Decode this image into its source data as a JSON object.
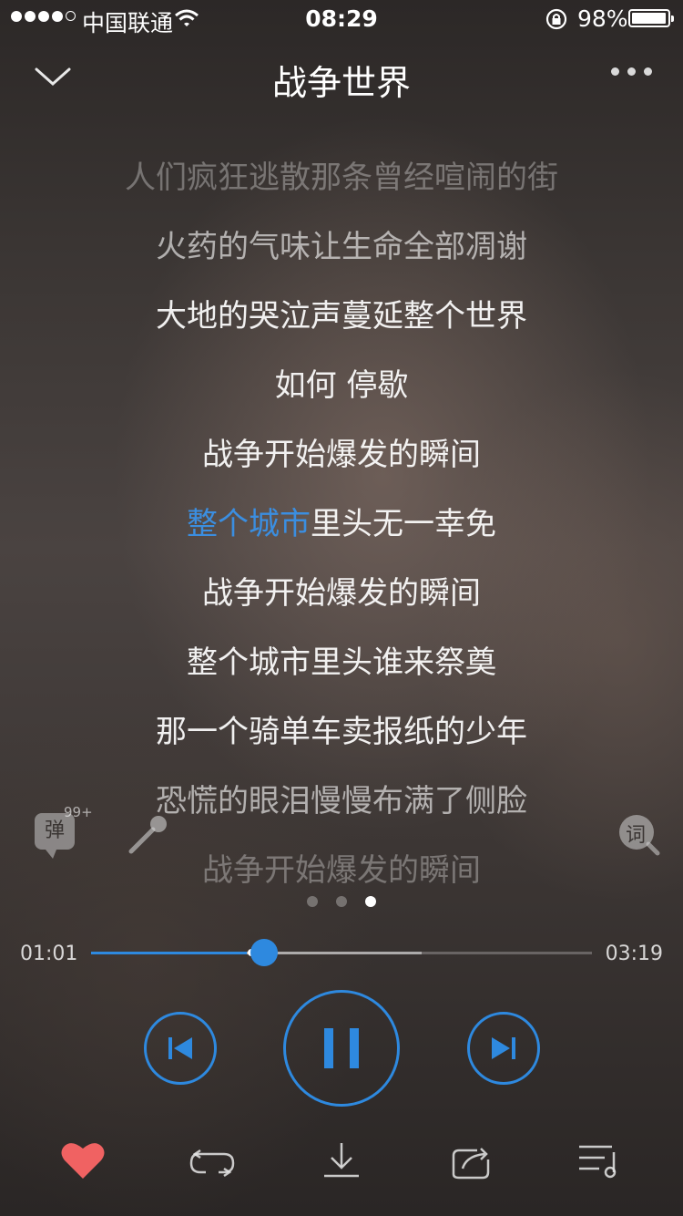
{
  "status_bar": {
    "carrier": "中国联通",
    "time": "08:29",
    "battery": "98%"
  },
  "header": {
    "title": "战争世界"
  },
  "lyrics": [
    {
      "text": "人们疯狂逃散那条曾经喧闹的街"
    },
    {
      "text": "火药的气味让生命全部凋谢"
    },
    {
      "text": "大地的哭泣声蔓延整个世界"
    },
    {
      "text": "如何 停歇"
    },
    {
      "text": "战争开始爆发的瞬间"
    },
    {
      "highlight": "整个城市",
      "rest": "里头无一幸免"
    },
    {
      "text": "战争开始爆发的瞬间"
    },
    {
      "text": "整个城市里头谁来祭奠"
    },
    {
      "text": "那一个骑单车卖报纸的少年"
    },
    {
      "text": "恐慌的眼泪慢慢布满了侧脸"
    },
    {
      "text": "战争开始爆发的瞬间"
    }
  ],
  "side": {
    "danmaku_label": "弹",
    "danmaku_count": "99+",
    "lyrics_button_label": "词"
  },
  "pager": {
    "count": 3,
    "active_index": 2
  },
  "progress": {
    "current": "01:01",
    "total": "03:19",
    "played_fraction": 0.31,
    "buffered_fraction": 0.66
  },
  "icons": {
    "back": "chevron-down-icon",
    "more": "more-icon",
    "prev": "skip-previous-icon",
    "pause": "pause-icon",
    "next": "skip-next-icon",
    "favorite": "heart-icon",
    "repeat": "repeat-icon",
    "download": "download-icon",
    "share": "share-icon",
    "playlist": "playlist-icon"
  },
  "colors": {
    "accent": "#2e89df",
    "favorite": "#f06262"
  }
}
